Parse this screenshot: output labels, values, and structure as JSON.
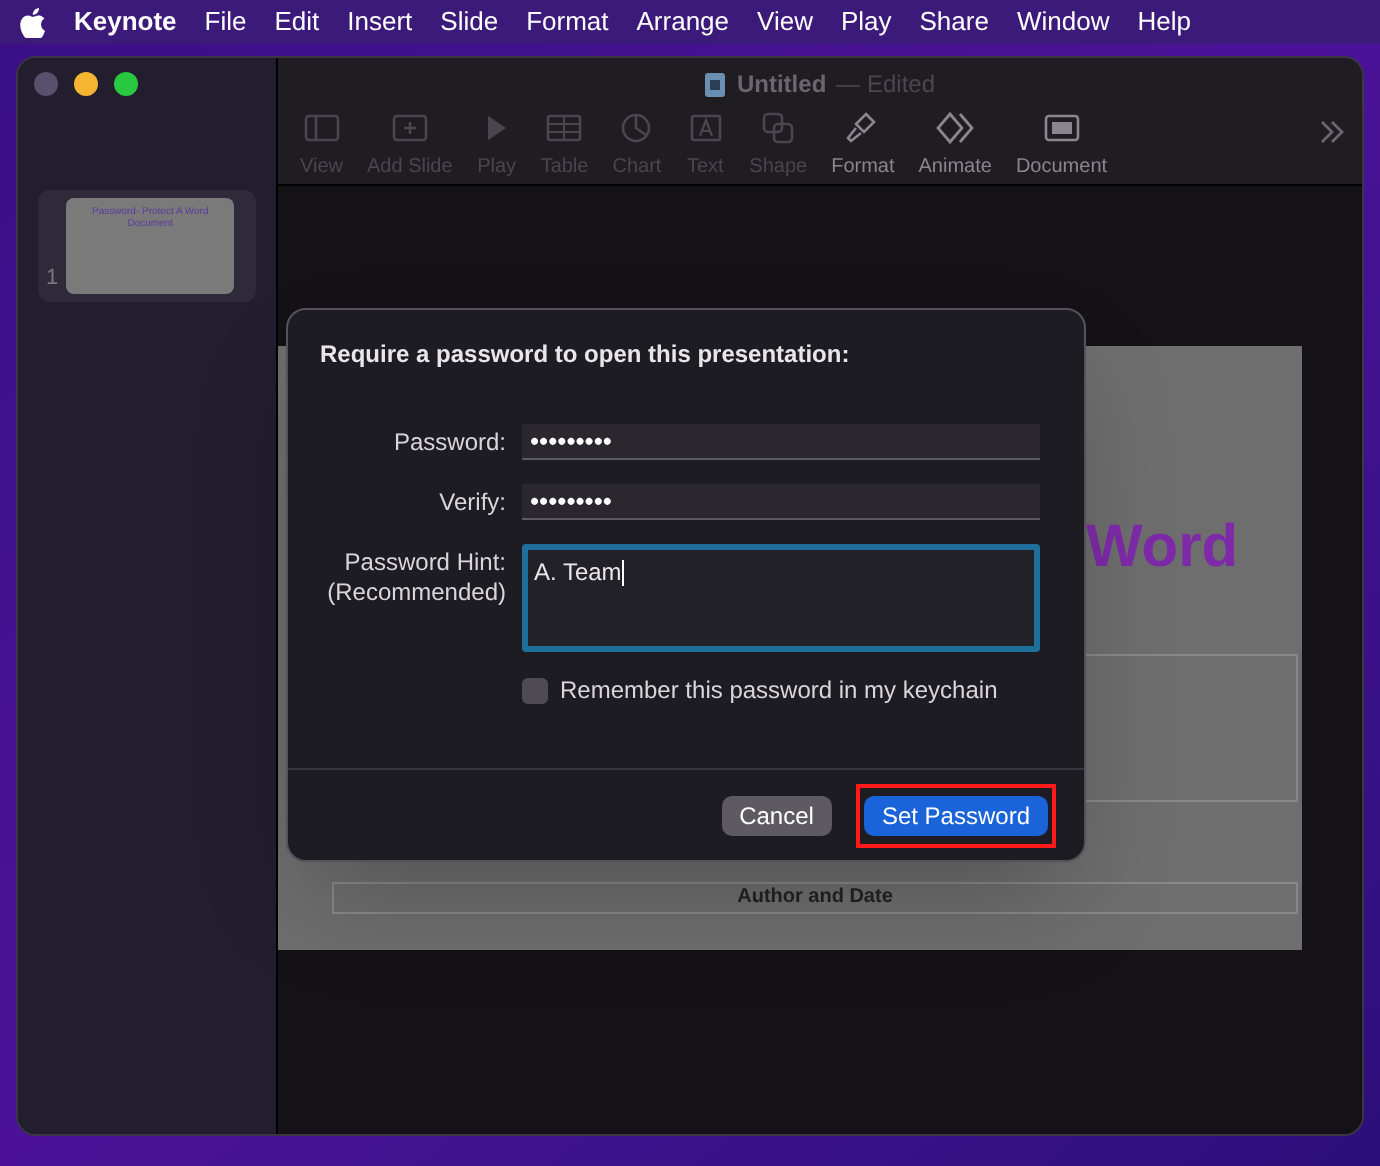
{
  "menu_bar": {
    "app": "Keynote",
    "items": [
      "File",
      "Edit",
      "Insert",
      "Slide",
      "Format",
      "Arrange",
      "View",
      "Play",
      "Share",
      "Window",
      "Help"
    ]
  },
  "window": {
    "title": "Untitled",
    "subtitle": "— Edited"
  },
  "toolbar": [
    {
      "label": "View",
      "disabled": true
    },
    {
      "label": "Add Slide",
      "disabled": true
    },
    {
      "label": "Play",
      "disabled": true
    },
    {
      "label": "Table",
      "disabled": true
    },
    {
      "label": "Chart",
      "disabled": true
    },
    {
      "label": "Text",
      "disabled": true
    },
    {
      "label": "Shape",
      "disabled": true
    },
    {
      "label": "Format",
      "disabled": false
    },
    {
      "label": "Animate",
      "disabled": false
    },
    {
      "label": "Document",
      "disabled": false
    }
  ],
  "navigator": {
    "slides": [
      {
        "number": "1",
        "title": "Password- Protect A Word Document",
        "selected": true
      }
    ]
  },
  "slide": {
    "title_fragment": "Word",
    "footer": "Author and Date"
  },
  "dialog": {
    "heading": "Require a password to open this presentation:",
    "fields": [
      {
        "label": "Password:",
        "value": "•••••••••",
        "kind": "secure"
      },
      {
        "label": "Verify:",
        "value": "•••••••••",
        "kind": "secure"
      },
      {
        "label": "Password Hint:",
        "label_2": "(Recommended)",
        "value": "A. Team",
        "kind": "multiline",
        "focused": true
      }
    ],
    "checkbox": {
      "label": "Remember this password in my keychain",
      "checked": false
    },
    "buttons": [
      {
        "label": "Cancel",
        "default": false,
        "highlighted": false
      },
      {
        "label": "Set Password",
        "default": true,
        "highlighted": true
      }
    ]
  }
}
